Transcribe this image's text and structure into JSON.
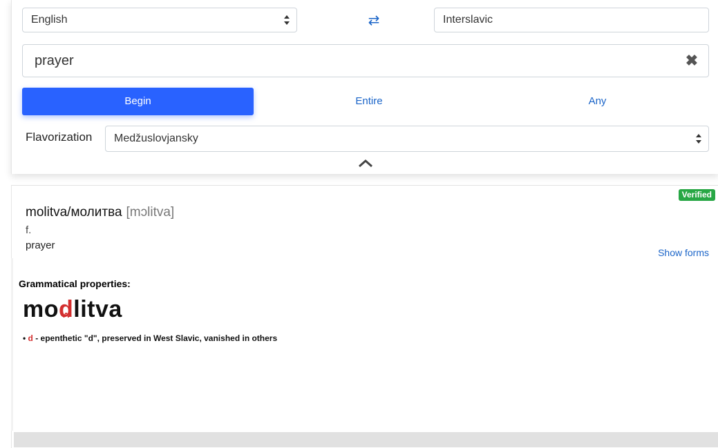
{
  "lang": {
    "from": "English",
    "swap_icon": "⇄",
    "to": "Interslavic"
  },
  "search": {
    "value": "prayer",
    "clear_icon": "✖"
  },
  "modes": [
    "Begin",
    "Entire",
    "Any"
  ],
  "flavorization": {
    "label": "Flavorization",
    "value": "Medžuslovjansky"
  },
  "result": {
    "badge": "Verified",
    "word": "molitva/молитва",
    "ipa": "[mɔlitva]",
    "pos": "f.",
    "meaning": "prayer",
    "show_forms": "Show forms"
  },
  "grammar": {
    "title": "Grammatical properties:",
    "word_pre": "mo",
    "word_hl": "d",
    "word_post": "litva",
    "note_bullet": "• ",
    "note_hl": "d",
    "note_text": " - epenthetic \"d\", preserved in West Slavic, vanished in others"
  },
  "colors": {
    "accent": "#2962ff",
    "link": "#1a64c8",
    "verified": "#28a745",
    "highlight": "#d32f2f"
  }
}
